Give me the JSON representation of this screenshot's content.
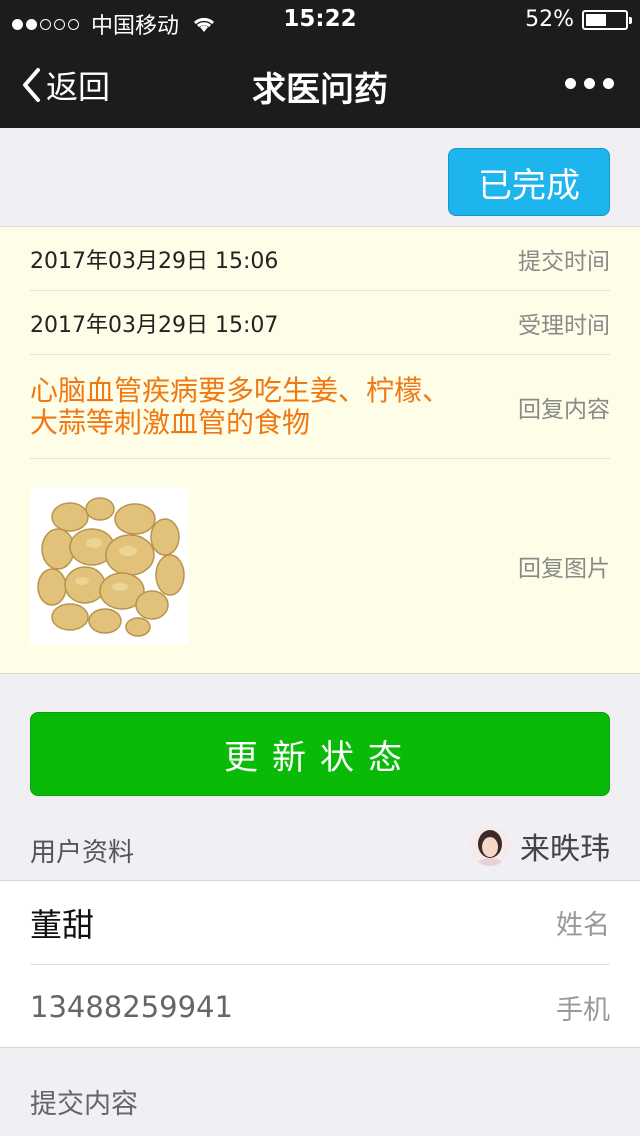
{
  "status_bar": {
    "carrier": "中国移动",
    "time": "15:22",
    "battery": "52%",
    "battery_level": 0.52
  },
  "nav": {
    "back_label": "返回",
    "title": "求医问药"
  },
  "status_button": "已完成",
  "info": {
    "submit_time": "2017年03月29日 15:06",
    "submit_time_label": "提交时间",
    "accept_time": "2017年03月29日 15:07",
    "accept_time_label": "受理时间",
    "reply_content": "心脑血管疾病要多吃生姜、柠檬、大蒜等刺激血管的食物",
    "reply_content_label": "回复内容",
    "reply_image_label": "回复图片"
  },
  "update_button": "更新状态",
  "user": {
    "section_label": "用户资料",
    "account_name": "来昳玮",
    "name": "董甜",
    "name_label": "姓名",
    "phone": "13488259941",
    "phone_label": "手机"
  },
  "submit_content_label": "提交内容",
  "colors": {
    "bar_bg": "#1c1c1f",
    "status_btn": "#1eb4ee",
    "update_btn": "#09bb07",
    "reply_text": "#f07814",
    "info_bg": "#fefee8"
  }
}
